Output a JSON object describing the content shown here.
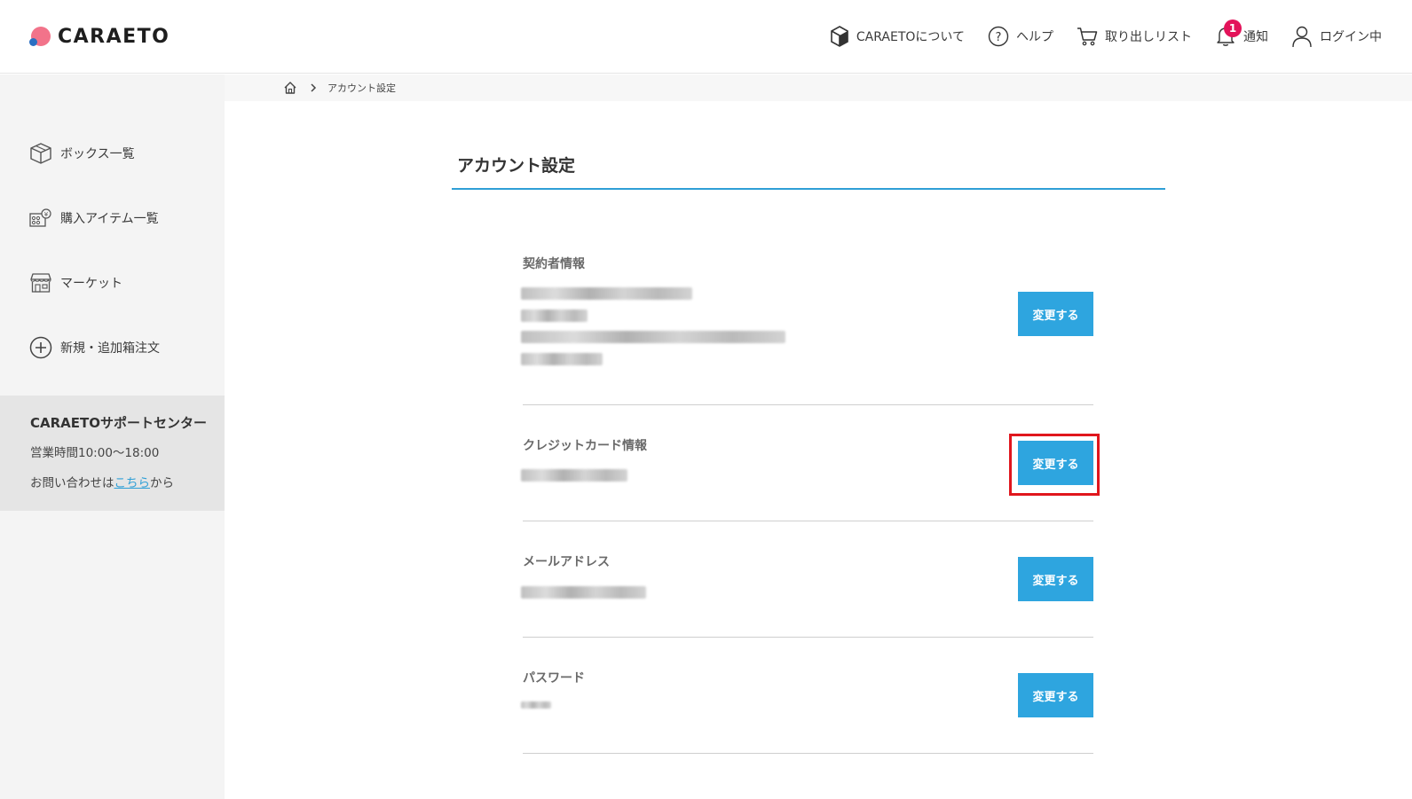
{
  "header": {
    "logo_text": "CARAETO",
    "nav": {
      "about": "CARAETOについて",
      "help": "ヘルプ",
      "retrieve_list": "取り出しリスト",
      "notifications": "通知",
      "notification_count": "1",
      "login": "ログイン中"
    }
  },
  "sidebar": {
    "items": [
      {
        "label": "ボックス一覧",
        "icon": "box-icon"
      },
      {
        "label": "購入アイテム一覧",
        "icon": "purchased-items-icon"
      },
      {
        "label": "マーケット",
        "icon": "market-store-icon"
      },
      {
        "label": "新規・追加箱注文",
        "icon": "plus-circle-icon"
      }
    ],
    "support": {
      "title": "CARAETOサポートセンター",
      "hours": "営業時間10:00～18:00",
      "contact_prefix": "お問い合わせは",
      "contact_link": "こちら",
      "contact_suffix": "から"
    }
  },
  "breadcrumb": {
    "current": "アカウント設定"
  },
  "main": {
    "title": "アカウント設定",
    "sections": [
      {
        "label": "契約者情報",
        "button": "変更する"
      },
      {
        "label": "クレジットカード情報",
        "button": "変更する"
      },
      {
        "label": "メールアドレス",
        "button": "変更する"
      },
      {
        "label": "パスワード",
        "button": "変更する"
      }
    ]
  },
  "colors": {
    "accent": "#2ea5df",
    "highlight": "#e0161d",
    "badge": "#e3135a",
    "logo_pink": "#f2738a",
    "logo_blue": "#2a6fc2"
  }
}
